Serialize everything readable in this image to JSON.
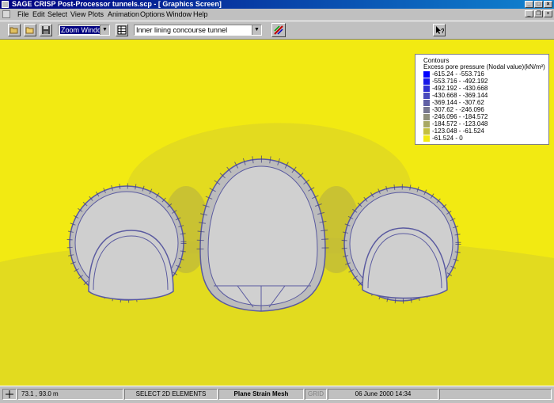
{
  "window": {
    "title": "SAGE CRISP Post-Processor tunnels.scp - [ Graphics Screen]"
  },
  "menu": [
    "File",
    "Edit",
    "Select",
    "View",
    "Plots",
    "Animation",
    "Options",
    "Window",
    "Help"
  ],
  "toolbar": {
    "zoom_value": "Zoom Window",
    "plot_value": "Inner lining concourse tunnel"
  },
  "legend": {
    "title": "Contours",
    "subtitle": "Excess pore pressure (Nodal value)(kN/m²)",
    "items": [
      {
        "label": "-615.24 - -553.716",
        "color": "#0000ff"
      },
      {
        "label": "-553.716 - -492.192",
        "color": "#1818e8"
      },
      {
        "label": "-492.192 - -430.668",
        "color": "#3030d2"
      },
      {
        "label": "-430.668 - -369.144",
        "color": "#4848bc"
      },
      {
        "label": "-369.144 - -307.62",
        "color": "#6060a6"
      },
      {
        "label": "-307.62 - -246.096",
        "color": "#787890"
      },
      {
        "label": "-246.096 - -184.572",
        "color": "#90907a"
      },
      {
        "label": "-184.572 - -123.048",
        "color": "#a8a864"
      },
      {
        "label": "-123.048 - -61.524",
        "color": "#c4c040"
      },
      {
        "label": "-61.524 - 0",
        "color": "#f2ea12"
      }
    ]
  },
  "status": {
    "coords": "73.1 , 93.0 m",
    "mode": "SELECT 2D ELEMENTS",
    "mesh": "Plane Strain Mesh",
    "grid": "GRID",
    "datetime": "06 June 2000 14:34"
  }
}
